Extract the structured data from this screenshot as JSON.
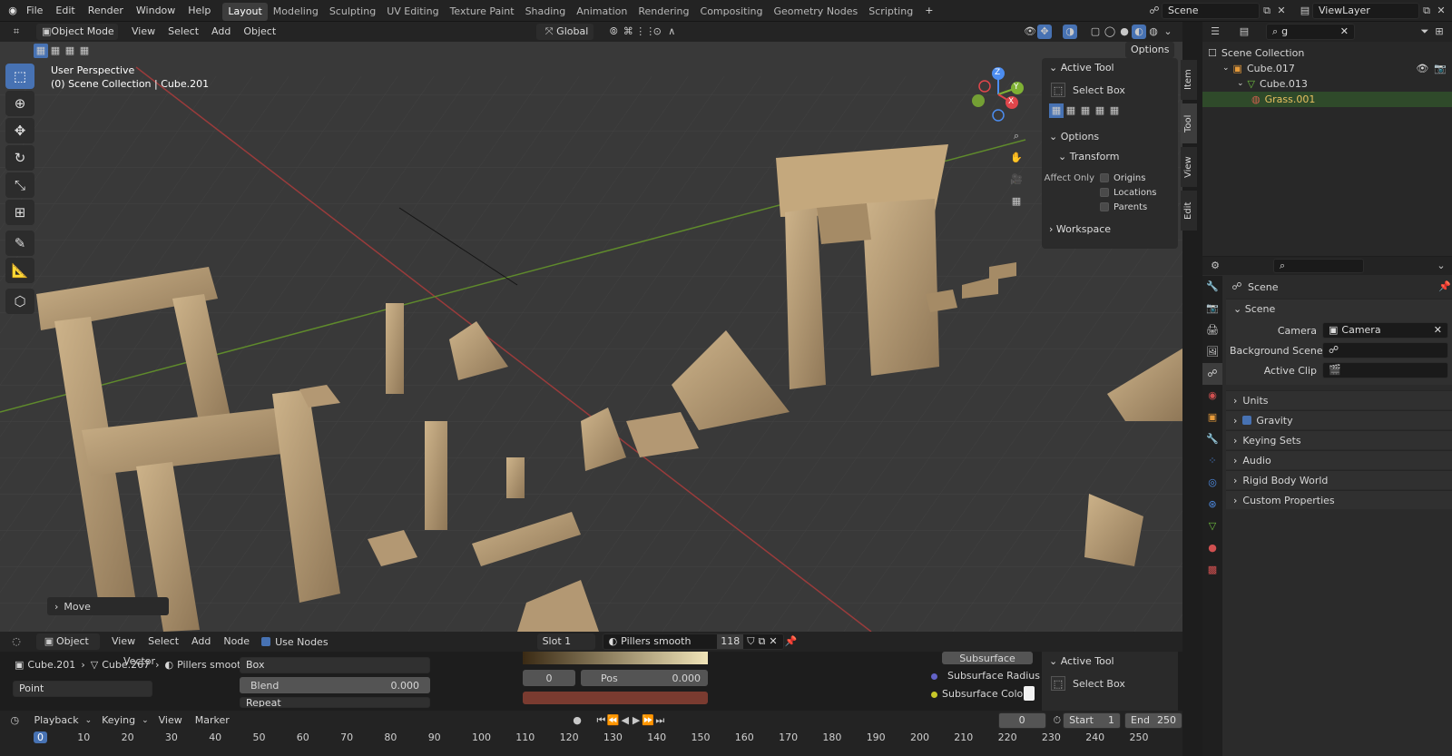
{
  "topbar": {
    "menus": [
      "File",
      "Edit",
      "Render",
      "Window",
      "Help"
    ],
    "workspaces": [
      "Layout",
      "Modeling",
      "Sculpting",
      "UV Editing",
      "Texture Paint",
      "Shading",
      "Animation",
      "Rendering",
      "Compositing",
      "Geometry Nodes",
      "Scripting"
    ],
    "active_workspace": "Layout",
    "add_tab": "+",
    "scene": "Scene",
    "view_layer": "ViewLayer"
  },
  "viewport": {
    "mode": "Object Mode",
    "menus": [
      "View",
      "Select",
      "Add",
      "Object"
    ],
    "transform_orientation": "Global",
    "options": "Options",
    "overlay_title": "User Perspective",
    "overlay_subtitle": "(0) Scene Collection | Cube.201",
    "move_panel": "Move",
    "gizmo": {
      "z": "Z",
      "y": "Y",
      "x": "X"
    }
  },
  "npanel": {
    "active_tool": "Active Tool",
    "select_box": "Select Box",
    "options": "Options",
    "transform": "Transform",
    "affect_only": "Affect Only",
    "origins": "Origins",
    "locations": "Locations",
    "parents": "Parents",
    "workspace": "Workspace",
    "tabs": [
      "Item",
      "Tool",
      "View",
      "Edit"
    ]
  },
  "outliner": {
    "search": "g",
    "items": [
      {
        "label": "Scene Collection",
        "indent": 0
      },
      {
        "label": "Cube.017",
        "indent": 1
      },
      {
        "label": "Cube.013",
        "indent": 2
      },
      {
        "label": "Grass.001",
        "indent": 3
      }
    ]
  },
  "properties": {
    "header": "Scene",
    "panel": "Scene",
    "camera_label": "Camera",
    "camera_value": "Camera",
    "bg_scene_label": "Background Scene",
    "active_clip_label": "Active Clip",
    "sections": [
      "Units",
      "Gravity",
      "Keying Sets",
      "Audio",
      "Rigid Body World",
      "Custom Properties"
    ]
  },
  "node_editor": {
    "type": "Object",
    "menus": [
      "View",
      "Select",
      "Add",
      "Node"
    ],
    "use_nodes": "Use Nodes",
    "slot": "Slot 1",
    "material": "Pillers smooth",
    "users": "118",
    "breadcrumb": [
      "Cube.201",
      "Cube.267",
      "Pillers smooth"
    ],
    "point": "Point",
    "vector": "Vector",
    "box": "Box",
    "blend_label": "Blend",
    "blend_value": "0.000",
    "repeat": "Repeat",
    "ramp_index": "0",
    "pos_label": "Pos",
    "pos_value": "0.000",
    "subsurface": "Subsurface",
    "subsurface_radius": "Subsurface Radius",
    "subsurface_color": "Subsurface Colo",
    "active_tool": "Active Tool",
    "select_box": "Select Box"
  },
  "timeline": {
    "menus": [
      "Playback",
      "Keying",
      "View",
      "Marker"
    ],
    "current_frame": "0",
    "start_label": "Start",
    "start": "1",
    "end_label": "End",
    "end": "250",
    "ticks": [
      "0",
      "10",
      "20",
      "30",
      "40",
      "50",
      "60",
      "70",
      "80",
      "90",
      "100",
      "110",
      "120",
      "130",
      "140",
      "150",
      "160",
      "170",
      "180",
      "190",
      "200",
      "210",
      "220",
      "230",
      "240",
      "250"
    ]
  }
}
